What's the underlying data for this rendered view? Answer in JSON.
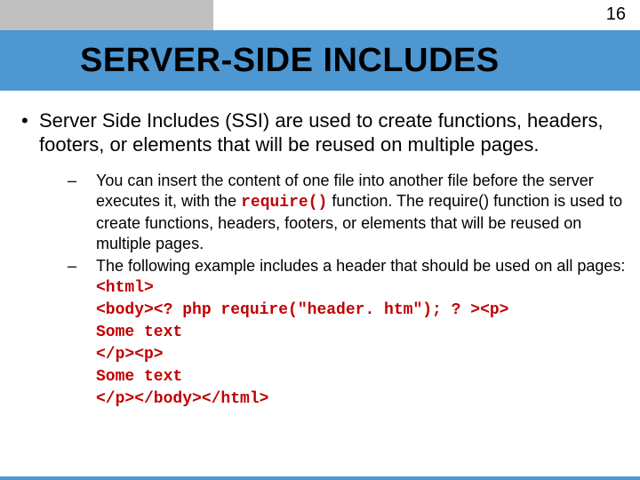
{
  "page_number": "16",
  "title": "SERVER-SIDE INCLUDES",
  "main_bullet": "Server Side Includes (SSI) are used to create functions, headers, footers, or elements that will be reused on multiple pages.",
  "sub1_pre": "You can insert the content of one file into another file before the server executes it, with the ",
  "sub1_code": "require()",
  "sub1_post": " function. The require() function is used to create functions, headers, footers, or elements that will be reused on multiple pages.",
  "sub2_intro": "The following example includes a header that should be used on all pages:",
  "code_l1": "<html>",
  "code_l2": "<body><? php require(\"header. htm\"); ? ><p>",
  "code_l3": "Some text",
  "code_l4": "</p><p>",
  "code_l5": "Some text",
  "code_l6": "</p></body></html>"
}
